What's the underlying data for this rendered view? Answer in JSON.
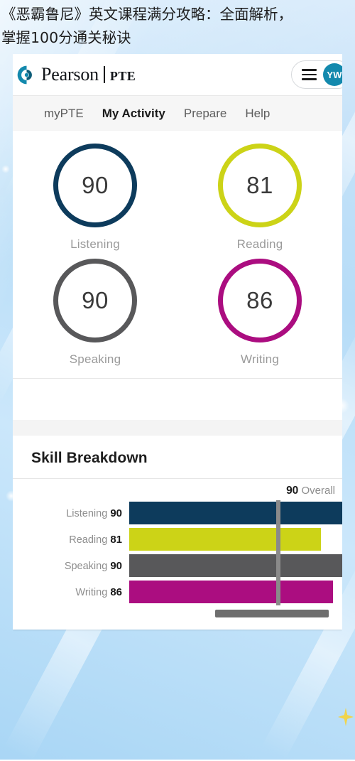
{
  "article": {
    "headline_line1": "《恶霸鲁尼》英文课程满分攻略：全面解析，",
    "headline_line2": "掌握100分通关秘诀"
  },
  "header": {
    "brand_primary": "Pearson",
    "brand_secondary": "PTE",
    "menu_icon": "hamburger-menu-icon",
    "avatar_initials": "YW",
    "avatar_color": "#1389ad"
  },
  "nav": {
    "items": [
      {
        "label": "myPTE",
        "active": false
      },
      {
        "label": "My Activity",
        "active": true
      },
      {
        "label": "Prepare",
        "active": false
      },
      {
        "label": "Help",
        "active": false
      }
    ]
  },
  "scores": {
    "items": [
      {
        "value": "90",
        "label": "Listening",
        "color": "#0d3b5c"
      },
      {
        "value": "81",
        "label": "Reading",
        "color": "#ccd317"
      },
      {
        "value": "90",
        "label": "Speaking",
        "color": "#58585a"
      },
      {
        "value": "86",
        "label": "Writing",
        "color": "#ab0d80"
      }
    ]
  },
  "skill_breakdown": {
    "title": "Skill Breakdown",
    "overall_value": "90",
    "overall_label": "Overall",
    "rows": [
      {
        "name": "Listening",
        "value": "90"
      },
      {
        "name": "Reading",
        "value": "81"
      },
      {
        "name": "Speaking",
        "value": "90"
      },
      {
        "name": "Writing",
        "value": "86"
      }
    ]
  },
  "chart_data": {
    "type": "bar",
    "title": "Skill Breakdown",
    "orientation": "horizontal",
    "categories": [
      "Listening",
      "Reading",
      "Speaking",
      "Writing"
    ],
    "values": [
      90,
      81,
      90,
      86
    ],
    "colors": [
      "#0d3b5c",
      "#ccd317",
      "#58585a",
      "#ab0d80"
    ],
    "xlabel": "",
    "ylabel": "",
    "xlim": [
      0,
      90
    ],
    "grid": false,
    "legend": "none",
    "annotations": [
      {
        "text": "90 Overall",
        "value": 90,
        "type": "reference-line",
        "color": "#8a8a8a"
      }
    ]
  }
}
